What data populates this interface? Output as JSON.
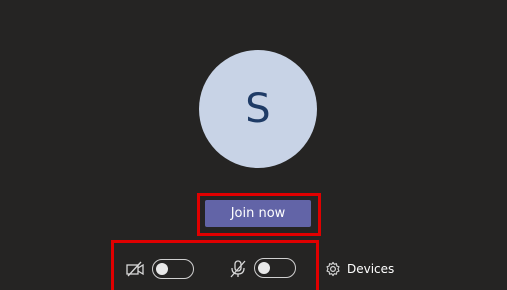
{
  "avatar": {
    "initial": "S",
    "background_color": "#c8d3e6",
    "text_color": "#1f3b66"
  },
  "join": {
    "label": "Join now",
    "color": "#6264a7"
  },
  "controls": {
    "camera": {
      "icon": "camera-off-icon",
      "enabled": false
    },
    "microphone": {
      "icon": "mic-off-icon",
      "enabled": false
    },
    "devices": {
      "icon": "gear-icon",
      "label": "Devices"
    }
  },
  "highlight_color": "#e00000"
}
